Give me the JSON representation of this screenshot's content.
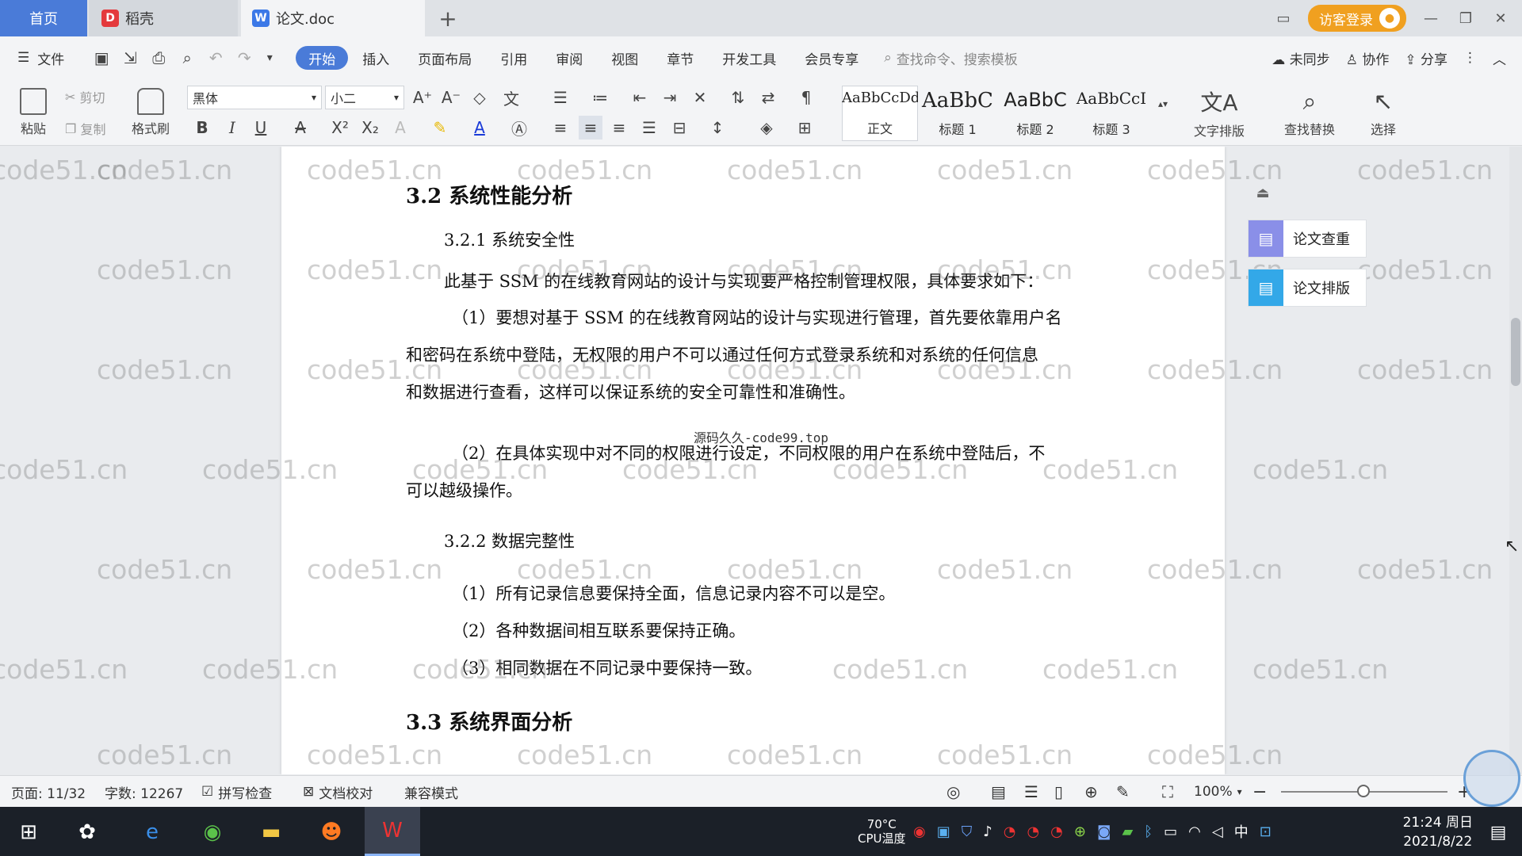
{
  "tabs": {
    "home": "首页",
    "daoke": "稻壳",
    "doc": "论文.doc",
    "add": "+"
  },
  "title_right": {
    "login": "访客登录"
  },
  "menu": {
    "file": "文件",
    "items": [
      "开始",
      "插入",
      "页面布局",
      "引用",
      "审阅",
      "视图",
      "章节",
      "开发工具",
      "会员专享"
    ],
    "search_placeholder": "查找命令、搜索模板",
    "sync": "未同步",
    "collab": "协作",
    "share": "分享"
  },
  "ribbon": {
    "paste": "粘贴",
    "cut": "剪切",
    "copy": "复制",
    "format_painter": "格式刷",
    "font_name": "黑体",
    "font_size": "小二",
    "styles": [
      {
        "sample": "AaBbCcDd",
        "label": "正文"
      },
      {
        "sample": "AaBbC",
        "label": "标题 1"
      },
      {
        "sample": "AaBbC",
        "label": "标题 2"
      },
      {
        "sample": "AaBbCcI",
        "label": "标题 3"
      }
    ],
    "text_layout": "文字排版",
    "find_replace": "查找替换",
    "select": "选择"
  },
  "document": {
    "h_3_2": "3.2 系统性能分析",
    "h_3_2_1": "3.2.1  系统安全性",
    "p1": "此基于 SSM 的在线教育网站的设计与实现要严格控制管理权限，具体要求如下：",
    "p2_line1": "（1）要想对基于 SSM 的在线教育网站的设计与实现进行管理，首先要依靠用户名",
    "p2_line2": "和密码在系统中登陆，无权限的用户不可以通过任何方式登录系统和对系统的任何信息",
    "p2_line3": "和数据进行查看，这样可以保证系统的安全可靠性和准确性。",
    "p3_line1": "（2）在具体实现中对不同的权限进行设定，不同权限的用户在系统中登陆后，不",
    "p3_line2": "可以越级操作。",
    "h_3_2_2": "3.2.2  数据完整性",
    "p4": "（1）所有记录信息要保持全面，信息记录内容不可以是空。",
    "p5": "（2）各种数据间相互联系要保持正确。",
    "p6": "（3）相同数据在不同记录中要保持一致。",
    "h_3_3": "3.3 系统界面分析",
    "center_watermark": "源码久久-code99.top",
    "watermark": "code51.cn"
  },
  "side_panel": {
    "check": "论文查重",
    "layout": "论文排版"
  },
  "status": {
    "page": "页面: 11/32",
    "words": "字数: 12267",
    "spell": "拼写检查",
    "proof": "文档校对",
    "compat": "兼容模式",
    "zoom": "100%"
  },
  "taskbar": {
    "temp": "70°C",
    "cpu": "CPU温度",
    "ime": "中",
    "time": "21:24 周日",
    "date": "2021/8/22"
  },
  "colors": {
    "accent": "#4a7bd8",
    "login": "#f0a020",
    "taskbar": "#1b2028"
  }
}
